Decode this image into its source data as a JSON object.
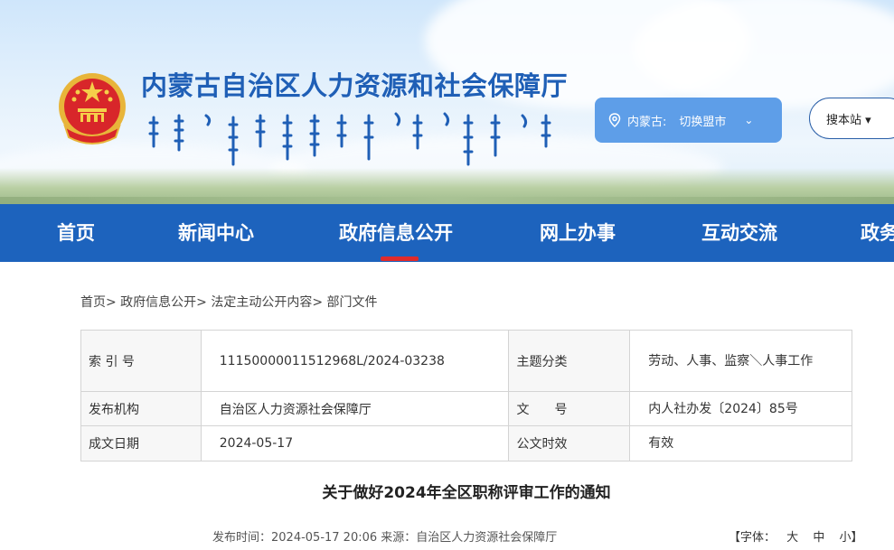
{
  "header": {
    "site_title": "内蒙古自治区人力资源和社会保障厅",
    "region_label": "内蒙古:",
    "region_switch": "切换盟市",
    "search_label": "搜本站 ▾"
  },
  "nav": {
    "items": [
      "首页",
      "新闻中心",
      "政府信息公开",
      "网上办事",
      "互动交流",
      "政务"
    ],
    "active_index": 2
  },
  "breadcrumb": "首页> 政府信息公开> 法定主动公开内容> 部门文件",
  "info_table": {
    "index_no_label": "索 引 号",
    "index_no_value": "11150000011512968L/2024-03238",
    "topic_label": "主题分类",
    "topic_value": "劳动、人事、监察＼人事工作",
    "publisher_label": "发布机构",
    "publisher_value": "自治区人力资源社会保障厅",
    "doc_no_label": "文　　号",
    "doc_no_value": "内人社办发〔2024〕85号",
    "date_label": "成文日期",
    "date_value": "2024-05-17",
    "validity_label": "公文时效",
    "validity_value": "有效"
  },
  "document": {
    "title": "关于做好2024年全区职称评审工作的通知",
    "meta": "发布时间：2024-05-17 20:06   来源：自治区人力资源社会保障厅",
    "font_label": "【字体：",
    "font_large": "大",
    "font_medium": "中",
    "font_small": "小】"
  },
  "colors": {
    "nav_bg": "#1d63bd",
    "title_blue": "#1f5fb6",
    "active_underline": "#e02b2b",
    "region_pill": "#5e9ee8"
  }
}
